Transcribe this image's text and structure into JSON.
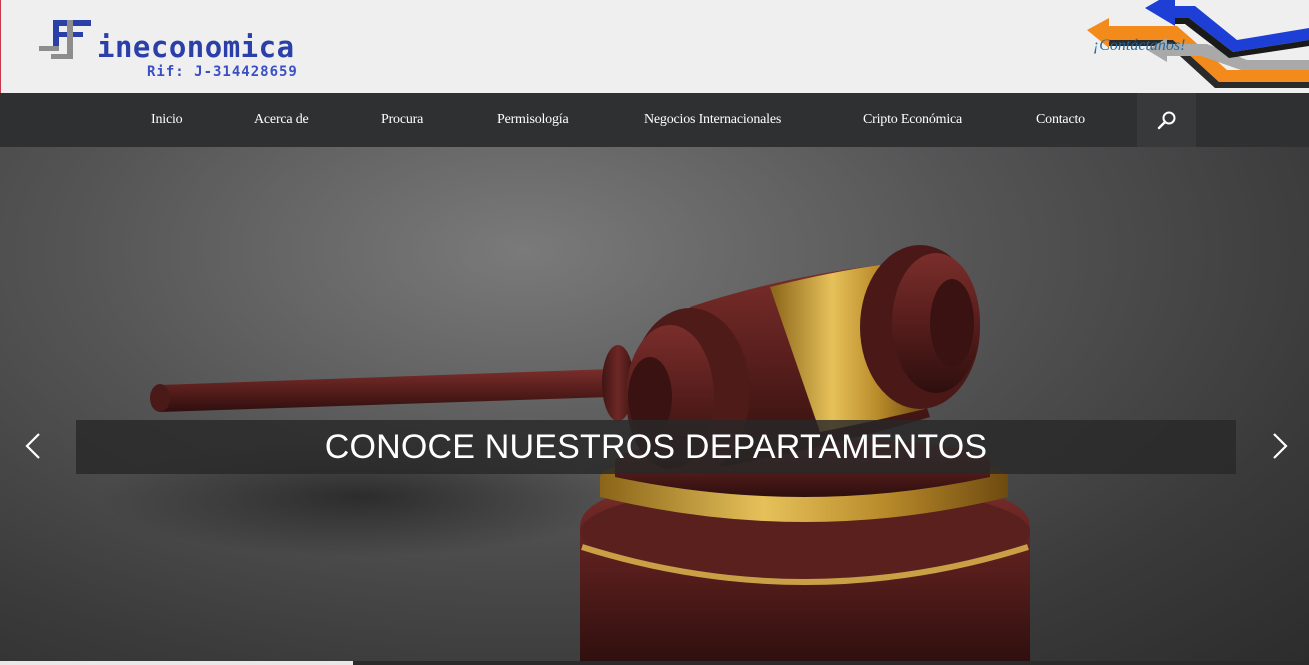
{
  "header": {
    "logo_text": "ineconomica",
    "logo_rif": "Rif: J-314428659",
    "contact_link": "¡Contáctanos!",
    "colors": {
      "logo_blue": "#2b3fa8",
      "arrow_orange": "#f28a1c",
      "arrow_blue": "#1d3fd6",
      "arrow_gray": "#9a9a9a"
    }
  },
  "nav": {
    "items": [
      {
        "label": "Inicio"
      },
      {
        "label": "Acerca de"
      },
      {
        "label": "Procura"
      },
      {
        "label": "Permisología"
      },
      {
        "label": "Negocios Internacionales"
      },
      {
        "label": "Cripto Económica"
      },
      {
        "label": "Contacto"
      }
    ],
    "search_icon": "search-icon"
  },
  "hero": {
    "caption": "CONOCE NUESTROS DEPARTAMENTOS",
    "prev_icon": "chevron-left-icon",
    "next_icon": "chevron-right-icon",
    "progress": 0.27
  }
}
